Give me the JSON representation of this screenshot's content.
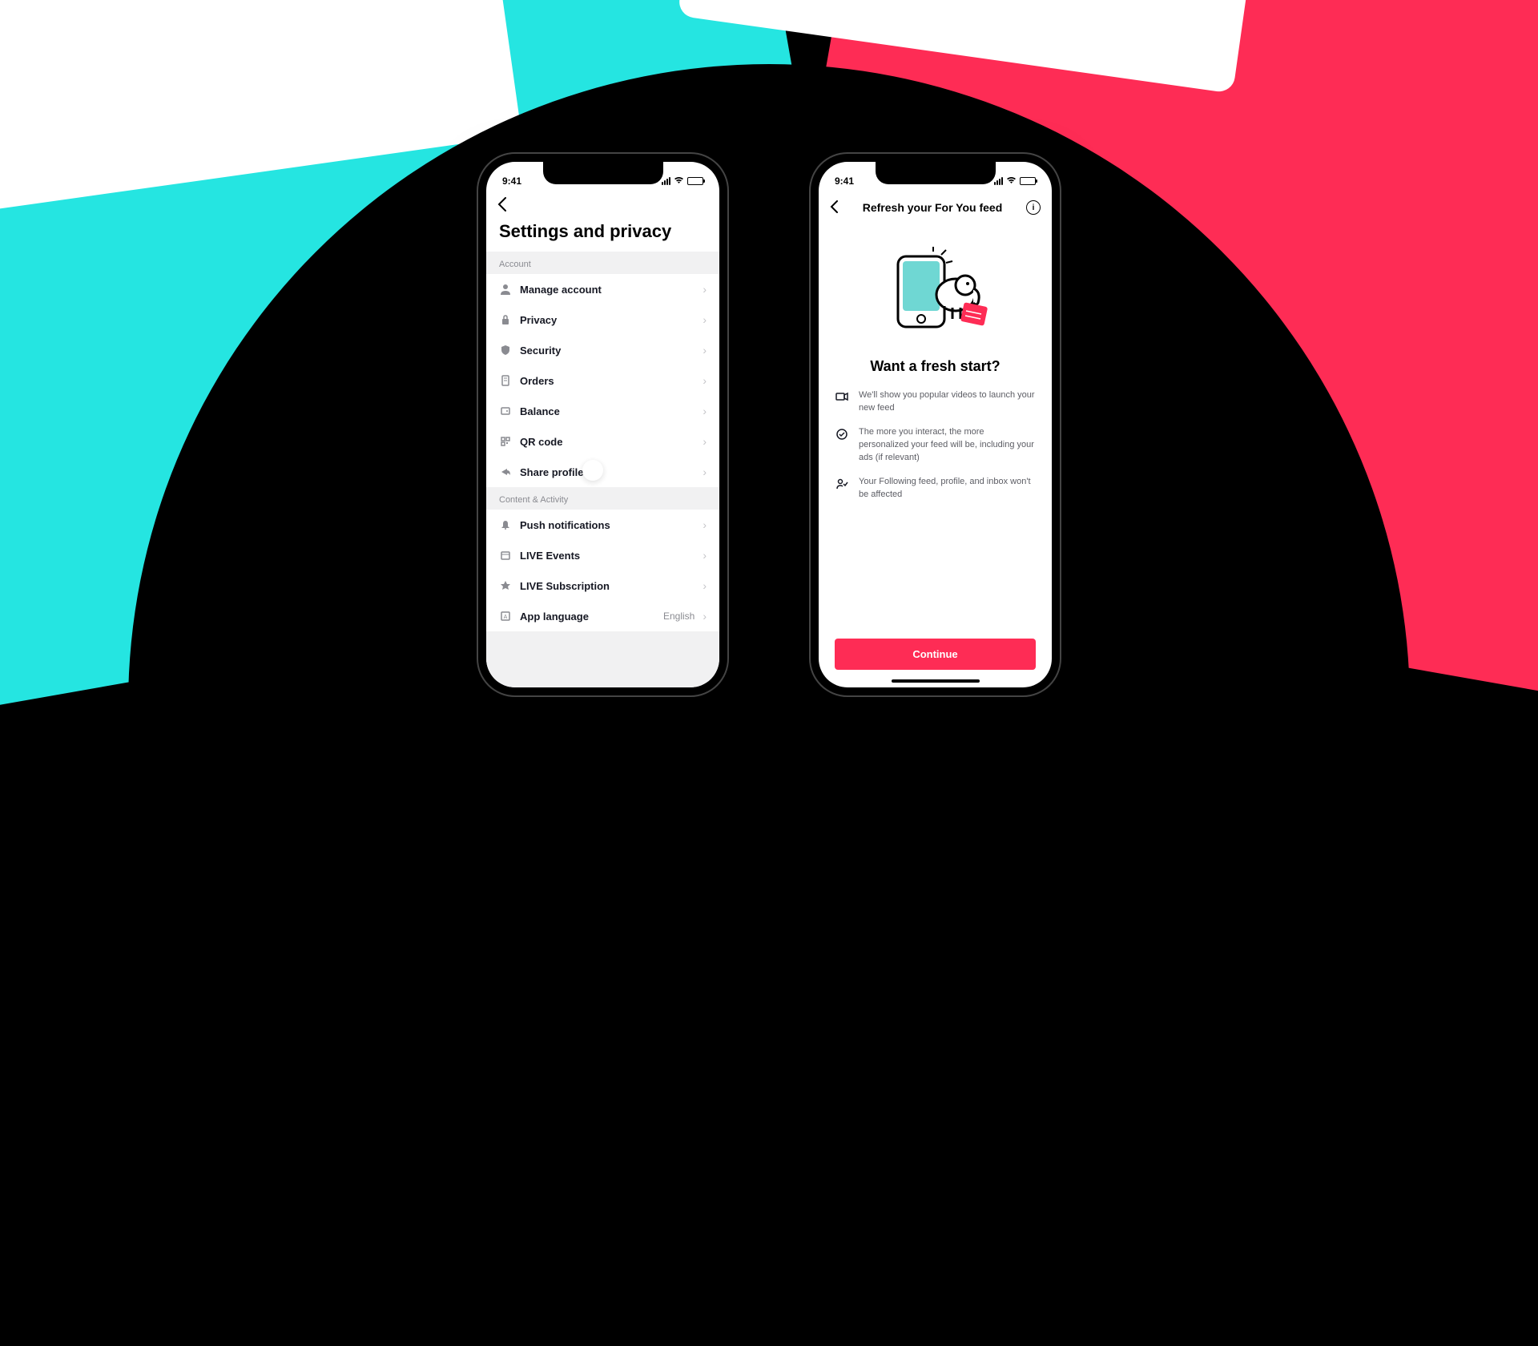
{
  "status": {
    "time": "9:41"
  },
  "left": {
    "title": "Settings and privacy",
    "sections": [
      {
        "header": "Account",
        "items": [
          {
            "label": "Manage account"
          },
          {
            "label": "Privacy"
          },
          {
            "label": "Security"
          },
          {
            "label": "Orders"
          },
          {
            "label": "Balance"
          },
          {
            "label": "QR code"
          },
          {
            "label": "Share profile"
          }
        ]
      },
      {
        "header": "Content & Activity",
        "items": [
          {
            "label": "Push notifications"
          },
          {
            "label": "LIVE Events"
          },
          {
            "label": "LIVE Subscription"
          },
          {
            "label": "App language",
            "trail": "English"
          }
        ]
      }
    ]
  },
  "right": {
    "title": "Refresh your For You feed",
    "heading": "Want a fresh start?",
    "benefits": [
      "We'll show you popular videos to launch your new feed",
      "The more you interact, the more personalized your feed will be, including your ads (if relevant)",
      "Your Following feed, profile, and inbox won't be affected"
    ],
    "cta": "Continue"
  }
}
